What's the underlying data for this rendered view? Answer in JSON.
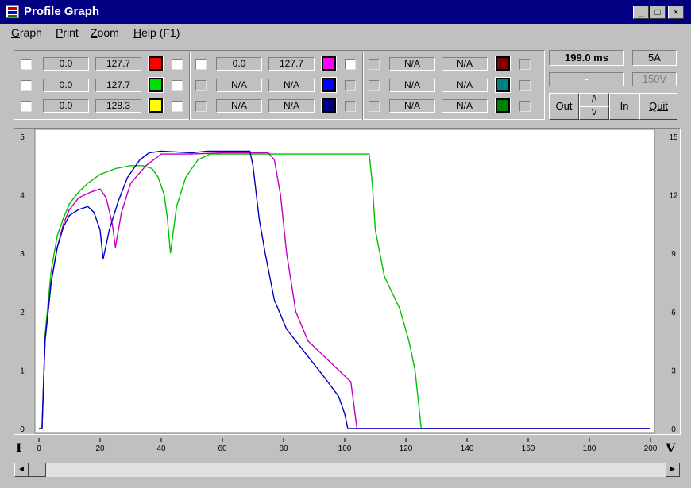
{
  "window": {
    "title": "Profile Graph",
    "minimize_glyph": "_",
    "maximize_glyph": "□",
    "close_glyph": "×"
  },
  "menu": [
    {
      "accel": "G",
      "rest": "raph"
    },
    {
      "accel": "P",
      "rest": "rint"
    },
    {
      "accel": "Z",
      "rest": "oom"
    },
    {
      "accel": "H",
      "rest": "elp (F1)"
    }
  ],
  "channels": {
    "group1": [
      {
        "a": "0.0",
        "b": "127.7",
        "color": "#ff0000"
      },
      {
        "a": "0.0",
        "b": "127.7",
        "color": "#00e000"
      },
      {
        "a": "0.0",
        "b": "128.3",
        "color": "#ffff00"
      }
    ],
    "group2": [
      {
        "a": "0.0",
        "b": "127.7",
        "color": "#ff00ff"
      },
      {
        "a": "N/A",
        "b": "N/A",
        "color": "#0000ff"
      },
      {
        "a": "N/A",
        "b": "N/A",
        "color": "#000080"
      }
    ],
    "group3": [
      {
        "a": "N/A",
        "b": "N/A",
        "color": "#800000"
      },
      {
        "a": "N/A",
        "b": "N/A",
        "color": "#008080"
      },
      {
        "a": "N/A",
        "b": "N/A",
        "color": "#008000"
      }
    ]
  },
  "controls": {
    "time": "199.0 ms",
    "current_range": "5A",
    "status": "-",
    "voltage_range": "150V",
    "out_label": "Out",
    "up_glyph": "/\\",
    "down_glyph": "\\/",
    "in_label": "In",
    "quit_label": "Quit"
  },
  "axis_letters": {
    "left": "I",
    "right": "V"
  },
  "scroll": {
    "left_glyph": "◄",
    "right_glyph": "►"
  },
  "chart_data": {
    "type": "line",
    "xlim": [
      0,
      200
    ],
    "ylim_left": [
      0,
      5
    ],
    "ylim_right": [
      0,
      15
    ],
    "x_ticks": [
      "0",
      "20",
      "40",
      "60",
      "80",
      "100",
      "120",
      "140",
      "160",
      "180",
      "200"
    ],
    "left_ticks": [
      "0",
      "1",
      "2",
      "3",
      "4",
      "5"
    ],
    "right_ticks": [
      "0",
      "3",
      "6",
      "9",
      "12",
      "15"
    ],
    "grid": false,
    "series": [
      {
        "color": "#00c000",
        "points": [
          [
            0,
            0
          ],
          [
            1,
            0
          ],
          [
            2,
            1.6
          ],
          [
            4,
            2.7
          ],
          [
            6,
            3.3
          ],
          [
            8,
            3.6
          ],
          [
            10,
            3.85
          ],
          [
            13,
            4.05
          ],
          [
            16,
            4.2
          ],
          [
            20,
            4.35
          ],
          [
            25,
            4.45
          ],
          [
            30,
            4.5
          ],
          [
            34,
            4.5
          ],
          [
            37,
            4.45
          ],
          [
            39,
            4.3
          ],
          [
            41,
            4.0
          ],
          [
            42,
            3.6
          ],
          [
            43,
            3.0
          ],
          [
            45,
            3.8
          ],
          [
            48,
            4.3
          ],
          [
            52,
            4.6
          ],
          [
            56,
            4.7
          ],
          [
            80,
            4.7
          ],
          [
            100,
            4.7
          ],
          [
            108,
            4.7
          ],
          [
            109,
            4.2
          ],
          [
            110,
            3.4
          ],
          [
            113,
            2.6
          ],
          [
            118,
            2.05
          ],
          [
            121,
            1.5
          ],
          [
            123,
            1.0
          ],
          [
            124,
            0.5
          ],
          [
            125,
            0
          ],
          [
            200,
            0
          ]
        ]
      },
      {
        "color": "#c000c0",
        "points": [
          [
            0,
            0
          ],
          [
            1,
            0
          ],
          [
            2,
            1.5
          ],
          [
            4,
            2.5
          ],
          [
            6,
            3.1
          ],
          [
            8,
            3.5
          ],
          [
            10,
            3.75
          ],
          [
            13,
            3.95
          ],
          [
            17,
            4.05
          ],
          [
            20,
            4.1
          ],
          [
            22,
            3.95
          ],
          [
            24,
            3.5
          ],
          [
            25,
            3.1
          ],
          [
            27,
            3.7
          ],
          [
            30,
            4.2
          ],
          [
            35,
            4.5
          ],
          [
            40,
            4.7
          ],
          [
            50,
            4.7
          ],
          [
            60,
            4.72
          ],
          [
            75,
            4.72
          ],
          [
            77,
            4.6
          ],
          [
            79,
            4.0
          ],
          [
            81,
            3.0
          ],
          [
            84,
            2.0
          ],
          [
            88,
            1.5
          ],
          [
            94,
            1.2
          ],
          [
            99,
            0.95
          ],
          [
            102,
            0.8
          ],
          [
            103,
            0.4
          ],
          [
            104,
            0
          ],
          [
            200,
            0
          ]
        ]
      },
      {
        "color": "#0000c0",
        "points": [
          [
            0,
            0
          ],
          [
            1,
            0
          ],
          [
            2,
            1.5
          ],
          [
            4,
            2.5
          ],
          [
            6,
            3.1
          ],
          [
            8,
            3.45
          ],
          [
            10,
            3.65
          ],
          [
            13,
            3.75
          ],
          [
            16,
            3.8
          ],
          [
            18,
            3.7
          ],
          [
            20,
            3.4
          ],
          [
            21,
            2.9
          ],
          [
            23,
            3.4
          ],
          [
            26,
            3.9
          ],
          [
            29,
            4.3
          ],
          [
            33,
            4.6
          ],
          [
            36,
            4.72
          ],
          [
            40,
            4.75
          ],
          [
            50,
            4.72
          ],
          [
            55,
            4.75
          ],
          [
            65,
            4.75
          ],
          [
            69,
            4.75
          ],
          [
            70,
            4.5
          ],
          [
            72,
            3.6
          ],
          [
            74,
            3.0
          ],
          [
            77,
            2.2
          ],
          [
            81,
            1.7
          ],
          [
            87,
            1.3
          ],
          [
            93,
            0.9
          ],
          [
            98,
            0.55
          ],
          [
            100,
            0.25
          ],
          [
            101,
            0
          ],
          [
            200,
            0
          ]
        ]
      }
    ]
  }
}
